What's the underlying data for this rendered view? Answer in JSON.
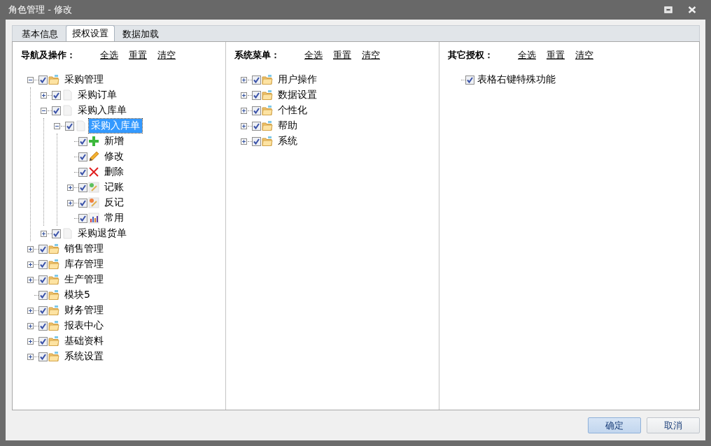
{
  "window": {
    "title": "角色管理 - 修改"
  },
  "tabs": [
    {
      "label": "基本信息",
      "selected": false
    },
    {
      "label": "授权设置",
      "selected": true
    },
    {
      "label": "数据加载",
      "selected": false
    }
  ],
  "columns": [
    {
      "heading": "导航及操作：",
      "links": [
        "全选",
        "重置",
        "清空"
      ],
      "tree": [
        {
          "label": "采购管理",
          "kind": "folder",
          "checked": true,
          "expanded": true,
          "selected": false,
          "children": [
            {
              "label": "采购订单",
              "kind": "page",
              "checked": true,
              "expanded": false,
              "selected": false
            },
            {
              "label": "采购入库单",
              "kind": "page",
              "checked": true,
              "expanded": true,
              "selected": false,
              "children": [
                {
                  "label": "采购入库单",
                  "kind": "page",
                  "checked": true,
                  "expanded": true,
                  "selected": true,
                  "children": [
                    {
                      "label": "新增",
                      "kind": "add",
                      "checked": true,
                      "selected": false
                    },
                    {
                      "label": "修改",
                      "kind": "edit",
                      "checked": true,
                      "selected": false
                    },
                    {
                      "label": "删除",
                      "kind": "delete",
                      "checked": true,
                      "selected": false
                    },
                    {
                      "label": "记账",
                      "kind": "post",
                      "checked": true,
                      "expanded": false,
                      "selected": false
                    },
                    {
                      "label": "反记",
                      "kind": "unpost",
                      "checked": true,
                      "expanded": false,
                      "selected": false
                    },
                    {
                      "label": "常用",
                      "kind": "chart",
                      "checked": true,
                      "selected": false
                    }
                  ]
                }
              ]
            },
            {
              "label": "采购退货单",
              "kind": "page",
              "checked": true,
              "expanded": false,
              "selected": false
            }
          ]
        },
        {
          "label": "销售管理",
          "kind": "folder",
          "checked": true,
          "expanded": false,
          "selected": false
        },
        {
          "label": "库存管理",
          "kind": "folder",
          "checked": true,
          "expanded": false,
          "selected": false
        },
        {
          "label": "生产管理",
          "kind": "folder",
          "checked": true,
          "expanded": false,
          "selected": false
        },
        {
          "label": "模块5",
          "kind": "folder",
          "checked": true,
          "selected": false
        },
        {
          "label": "财务管理",
          "kind": "folder",
          "checked": true,
          "expanded": false,
          "selected": false
        },
        {
          "label": "报表中心",
          "kind": "folder",
          "checked": true,
          "expanded": false,
          "selected": false
        },
        {
          "label": "基础资料",
          "kind": "folder",
          "checked": true,
          "expanded": false,
          "selected": false
        },
        {
          "label": "系统设置",
          "kind": "folder",
          "checked": true,
          "expanded": false,
          "selected": false
        }
      ]
    },
    {
      "heading": "系统菜单：",
      "links": [
        "全选",
        "重置",
        "清空"
      ],
      "tree": [
        {
          "label": "用户操作",
          "kind": "folder",
          "checked": true,
          "expanded": false,
          "selected": false
        },
        {
          "label": "数据设置",
          "kind": "folder",
          "checked": true,
          "expanded": false,
          "selected": false
        },
        {
          "label": "个性化",
          "kind": "folder",
          "checked": true,
          "expanded": false,
          "selected": false
        },
        {
          "label": "帮助",
          "kind": "folder",
          "checked": true,
          "expanded": false,
          "selected": false
        },
        {
          "label": "系统",
          "kind": "folder",
          "checked": true,
          "expanded": false,
          "selected": false
        }
      ]
    },
    {
      "heading": "其它授权：",
      "links": [
        "全选",
        "重置",
        "清空"
      ],
      "tree": [
        {
          "label": "表格右键特殊功能",
          "kind": "plain",
          "checked": true,
          "selected": false
        }
      ]
    }
  ],
  "buttons": [
    {
      "label": "确定",
      "kind": "primary"
    },
    {
      "label": "取消",
      "kind": "secondary"
    }
  ]
}
